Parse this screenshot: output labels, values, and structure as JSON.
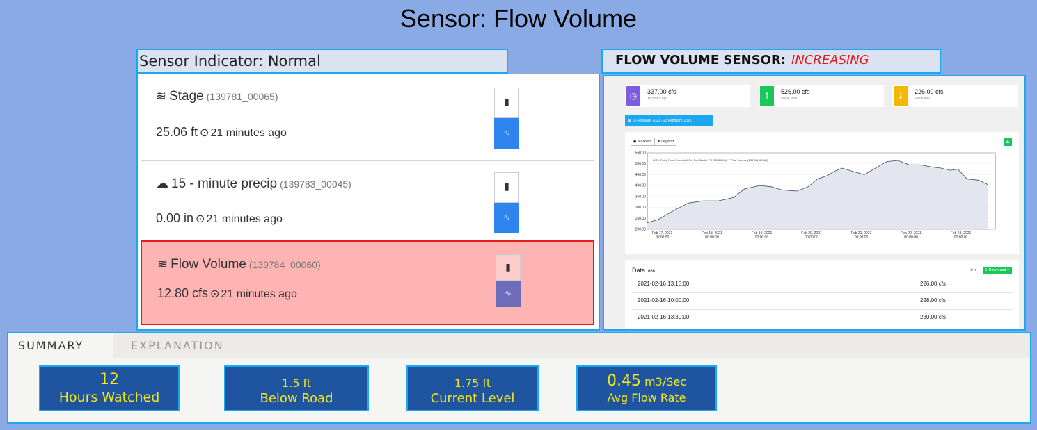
{
  "title": "Sensor: Flow Volume",
  "indicator": "Sensor Indicator: Normal",
  "sensors": [
    {
      "name": "Stage",
      "code": "(139781_00065)",
      "value": "25.06 ft",
      "ago": "21 minutes ago",
      "icon": "waves-icon"
    },
    {
      "name": "15 - minute precip",
      "code": "(139783_00045)",
      "value": "0.00 in",
      "ago": "21 minutes ago",
      "icon": "rain-cloud-icon"
    },
    {
      "name": "Flow Volume",
      "code": "(139784_00060)",
      "value": "12.80 cfs",
      "ago": "21 minutes ago",
      "icon": "waves-icon"
    }
  ],
  "trend": {
    "label": "FLOW VOLUME SENSOR:",
    "value": "INCREASING"
  },
  "dashboard": {
    "stats": [
      {
        "value": "337.00 cfs",
        "sub": "16 hours ago",
        "color": "#7d5ce0",
        "icon": "clock-icon"
      },
      {
        "value": "526.00 cfs",
        "sub": "Value Max",
        "color": "#1ac85a",
        "icon": "arrow-up-icon"
      },
      {
        "value": "226.00 cfs",
        "sub": "Value Min",
        "color": "#f5b800",
        "icon": "arrow-down-icon"
      }
    ],
    "date_range": "16 February, 2021 - 23 February, 2021",
    "markers_label": "Markers",
    "legend_label": "Legend",
    "chart_legend": "W Fk Trinity Rv at Greenbelt Rd, Fort Worth, TX (08049000) ***Flow Volume (139784_00060)",
    "data_title": "Data",
    "data_count": "666",
    "download_label": "Download",
    "rows": [
      {
        "date": "2021-02-16 13:15:00",
        "flow": "226.00 cfs"
      },
      {
        "date": "2021-02-16 10:00:00",
        "flow": "228.00 cfs"
      },
      {
        "date": "2021-02-16 13:30:00",
        "flow": "230.00 cfs"
      }
    ]
  },
  "chart_data": {
    "type": "line",
    "title": "",
    "xlabel": "",
    "ylabel": "",
    "ylim": [
      200,
      550
    ],
    "yticks": [
      "550.00",
      "500.00",
      "450.00",
      "400.00",
      "350.00",
      "300.00",
      "250.00",
      "200.00"
    ],
    "xticks": [
      "Feb 17, 2021 00:00:00",
      "Feb 18, 2021 00:00:00",
      "Feb 19, 2021 00:00:00",
      "Feb 20, 2021 00:00:00",
      "Feb 21, 2021 00:00:00",
      "Feb 22, 2021 00:00:00",
      "Feb 23, 2021 00:00:00"
    ],
    "x_days": [
      0.0,
      0.3,
      0.7,
      1.1,
      1.5,
      1.9,
      2.3,
      2.6,
      3.0,
      3.3,
      3.6,
      4.0,
      4.3,
      4.55,
      4.8,
      5.0,
      5.2,
      5.5,
      5.8,
      6.1,
      6.4,
      6.7,
      7.0,
      7.3,
      7.6,
      7.85,
      8.1,
      8.3,
      8.55,
      8.85,
      9.1
    ],
    "series": [
      {
        "values": [
          230,
          245,
          285,
          320,
          330,
          330,
          345,
          385,
          400,
          395,
          380,
          375,
          395,
          430,
          445,
          465,
          480,
          465,
          450,
          480,
          510,
          515,
          495,
          495,
          485,
          480,
          470,
          475,
          430,
          425,
          405
        ]
      }
    ]
  },
  "summary": {
    "tabs": [
      "SUMMARY",
      "EXPLANATION"
    ],
    "cards": [
      {
        "value": "12",
        "label": "Hours Watched"
      },
      {
        "value": "1.5 ft",
        "label": "Below Road"
      },
      {
        "value": "1.75 ft",
        "label": "Current Level"
      },
      {
        "value": "0.45",
        "unit": "m3/Sec",
        "label": "Avg Flow Rate"
      }
    ]
  }
}
